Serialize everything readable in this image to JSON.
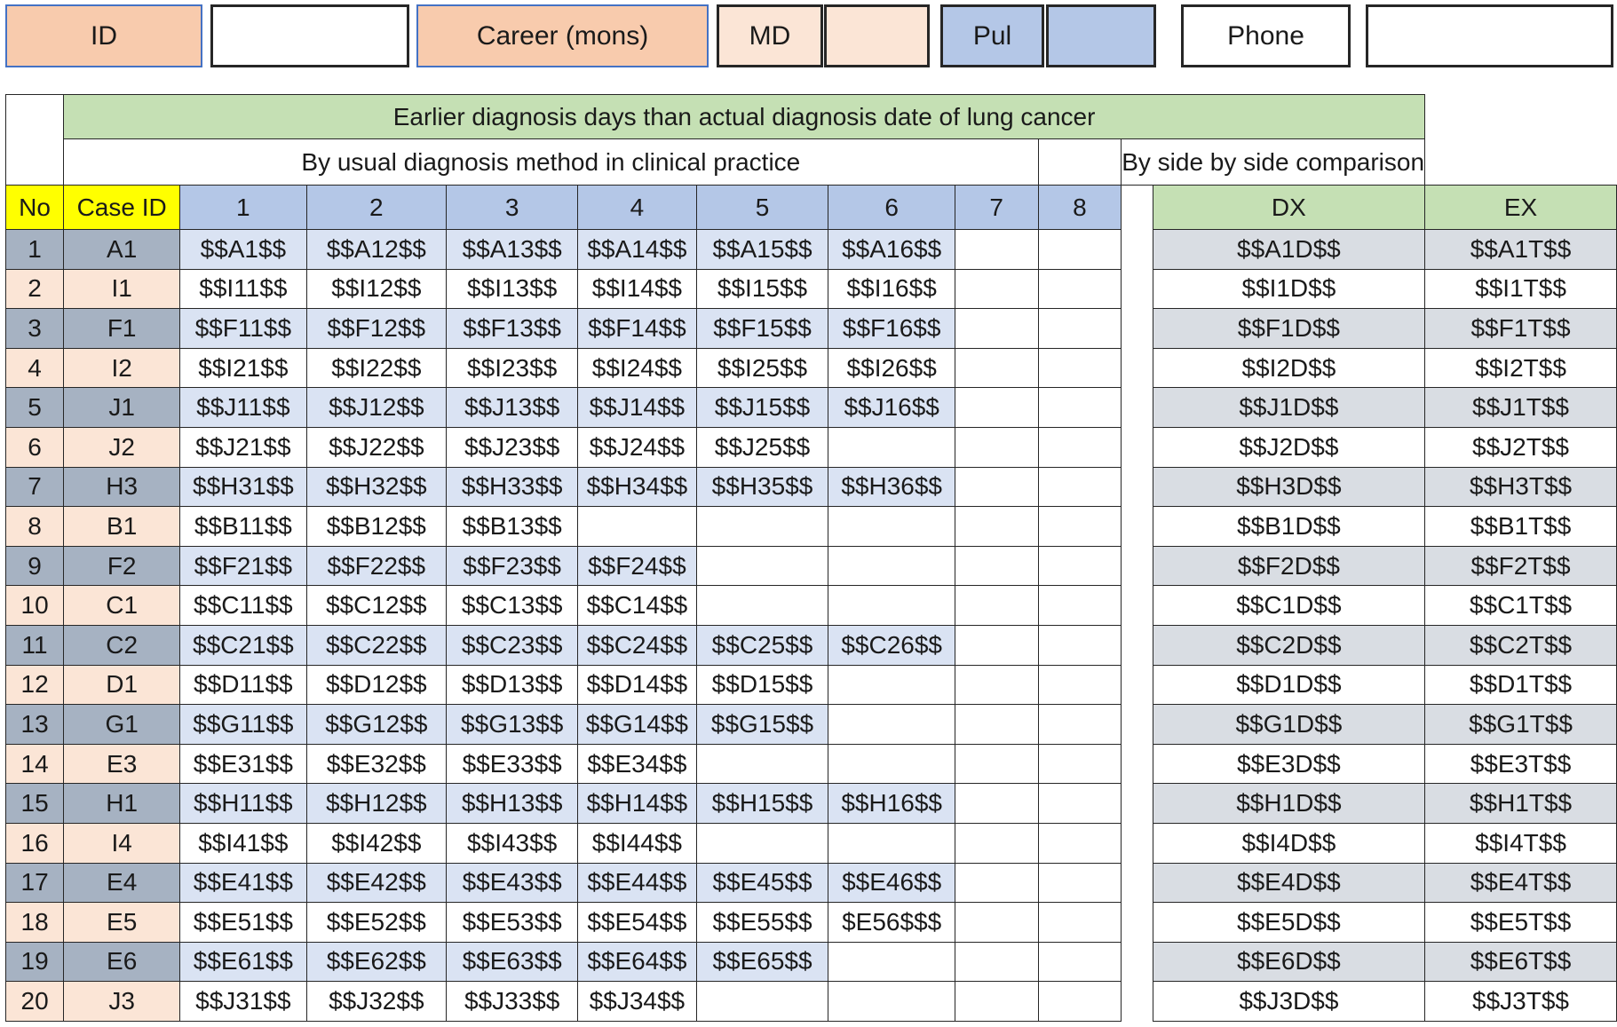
{
  "header": {
    "id_label": "ID",
    "id_value": "",
    "career_label": "Career (mons)",
    "md_label": "MD",
    "md_value": "",
    "pul_label": "Pul",
    "pul_value": "",
    "phone_label": "Phone",
    "phone_value": ""
  },
  "table": {
    "main_header": "Earlier diagnosis days than actual diagnosis date of lung cancer",
    "usual_header": "By usual diagnosis method in clinical practice",
    "side_header": "By side by side comparison",
    "columns": {
      "no": "No",
      "case_id": "Case ID",
      "methods": [
        "1",
        "2",
        "3",
        "4",
        "5",
        "6",
        "7",
        "8"
      ],
      "dx": "DX",
      "ex": "EX"
    },
    "rows": [
      {
        "no": "1",
        "case_id": "A1",
        "values": [
          "$$A1$$",
          "$$A12$$",
          "$$A13$$",
          "$$A14$$",
          "$$A15$$",
          "$$A16$$",
          "",
          ""
        ],
        "dx": "$$A1D$$",
        "ex": "$$A1T$$"
      },
      {
        "no": "2",
        "case_id": "I1",
        "values": [
          "$$I11$$",
          "$$I12$$",
          "$$I13$$",
          "$$I14$$",
          "$$I15$$",
          "$$I16$$",
          "",
          ""
        ],
        "dx": "$$I1D$$",
        "ex": "$$I1T$$"
      },
      {
        "no": "3",
        "case_id": "F1",
        "values": [
          "$$F11$$",
          "$$F12$$",
          "$$F13$$",
          "$$F14$$",
          "$$F15$$",
          "$$F16$$",
          "",
          ""
        ],
        "dx": "$$F1D$$",
        "ex": "$$F1T$$"
      },
      {
        "no": "4",
        "case_id": "I2",
        "values": [
          "$$I21$$",
          "$$I22$$",
          "$$I23$$",
          "$$I24$$",
          "$$I25$$",
          "$$I26$$",
          "",
          ""
        ],
        "dx": "$$I2D$$",
        "ex": "$$I2T$$"
      },
      {
        "no": "5",
        "case_id": "J1",
        "values": [
          "$$J11$$",
          "$$J12$$",
          "$$J13$$",
          "$$J14$$",
          "$$J15$$",
          "$$J16$$",
          "",
          ""
        ],
        "dx": "$$J1D$$",
        "ex": "$$J1T$$"
      },
      {
        "no": "6",
        "case_id": "J2",
        "values": [
          "$$J21$$",
          "$$J22$$",
          "$$J23$$",
          "$$J24$$",
          "$$J25$$",
          "",
          "",
          ""
        ],
        "dx": "$$J2D$$",
        "ex": "$$J2T$$"
      },
      {
        "no": "7",
        "case_id": "H3",
        "values": [
          "$$H31$$",
          "$$H32$$",
          "$$H33$$",
          "$$H34$$",
          "$$H35$$",
          "$$H36$$",
          "",
          ""
        ],
        "dx": "$$H3D$$",
        "ex": "$$H3T$$"
      },
      {
        "no": "8",
        "case_id": "B1",
        "values": [
          "$$B11$$",
          "$$B12$$",
          "$$B13$$",
          "",
          "",
          "",
          "",
          ""
        ],
        "dx": "$$B1D$$",
        "ex": "$$B1T$$"
      },
      {
        "no": "9",
        "case_id": "F2",
        "values": [
          "$$F21$$",
          "$$F22$$",
          "$$F23$$",
          "$$F24$$",
          "",
          "",
          "",
          ""
        ],
        "dx": "$$F2D$$",
        "ex": "$$F2T$$"
      },
      {
        "no": "10",
        "case_id": "C1",
        "values": [
          "$$C11$$",
          "$$C12$$",
          "$$C13$$",
          "$$C14$$",
          "",
          "",
          "",
          ""
        ],
        "dx": "$$C1D$$",
        "ex": "$$C1T$$"
      },
      {
        "no": "11",
        "case_id": "C2",
        "values": [
          "$$C21$$",
          "$$C22$$",
          "$$C23$$",
          "$$C24$$",
          "$$C25$$",
          "$$C26$$",
          "",
          ""
        ],
        "dx": "$$C2D$$",
        "ex": "$$C2T$$"
      },
      {
        "no": "12",
        "case_id": "D1",
        "values": [
          "$$D11$$",
          "$$D12$$",
          "$$D13$$",
          "$$D14$$",
          "$$D15$$",
          "",
          "",
          ""
        ],
        "dx": "$$D1D$$",
        "ex": "$$D1T$$"
      },
      {
        "no": "13",
        "case_id": "G1",
        "values": [
          "$$G11$$",
          "$$G12$$",
          "$$G13$$",
          "$$G14$$",
          "$$G15$$",
          "",
          "",
          ""
        ],
        "dx": "$$G1D$$",
        "ex": "$$G1T$$"
      },
      {
        "no": "14",
        "case_id": "E3",
        "values": [
          "$$E31$$",
          "$$E32$$",
          "$$E33$$",
          "$$E34$$",
          "",
          "",
          "",
          ""
        ],
        "dx": "$$E3D$$",
        "ex": "$$E3T$$"
      },
      {
        "no": "15",
        "case_id": "H1",
        "values": [
          "$$H11$$",
          "$$H12$$",
          "$$H13$$",
          "$$H14$$",
          "$$H15$$",
          "$$H16$$",
          "",
          ""
        ],
        "dx": "$$H1D$$",
        "ex": "$$H1T$$"
      },
      {
        "no": "16",
        "case_id": "I4",
        "values": [
          "$$I41$$",
          "$$I42$$",
          "$$I43$$",
          "$$I44$$",
          "",
          "",
          "",
          ""
        ],
        "dx": "$$I4D$$",
        "ex": "$$I4T$$"
      },
      {
        "no": "17",
        "case_id": "E4",
        "values": [
          "$$E41$$",
          "$$E42$$",
          "$$E43$$",
          "$$E44$$",
          "$$E45$$",
          "$$E46$$",
          "",
          ""
        ],
        "dx": "$$E4D$$",
        "ex": "$$E4T$$"
      },
      {
        "no": "18",
        "case_id": "E5",
        "values": [
          "$$E51$$",
          "$$E52$$",
          "$$E53$$",
          "$$E54$$",
          "$$E55$$",
          "$E56$$$",
          "",
          ""
        ],
        "dx": "$$E5D$$",
        "ex": "$$E5T$$"
      },
      {
        "no": "19",
        "case_id": "E6",
        "values": [
          "$$E61$$",
          "$$E62$$",
          "$$E63$$",
          "$$E64$$",
          "$$E65$$",
          "",
          "",
          ""
        ],
        "dx": "$$E6D$$",
        "ex": "$$E6T$$"
      },
      {
        "no": "20",
        "case_id": "J3",
        "values": [
          "$$J31$$",
          "$$J32$$",
          "$$J33$$",
          "$$J34$$",
          "",
          "",
          "",
          ""
        ],
        "dx": "$$J3D$$",
        "ex": "$$J3T$$"
      }
    ]
  },
  "colors": {
    "peach_header": "#f8cbad",
    "peach_light": "#fbe5d6",
    "blue_header": "#b4c7e7",
    "lavender_row": "#dae3f3",
    "slate_cell": "#a6b2c2",
    "green_header": "#c5e0b4",
    "yellow_header": "#ffff00",
    "gray_side": "#d9dde3"
  }
}
